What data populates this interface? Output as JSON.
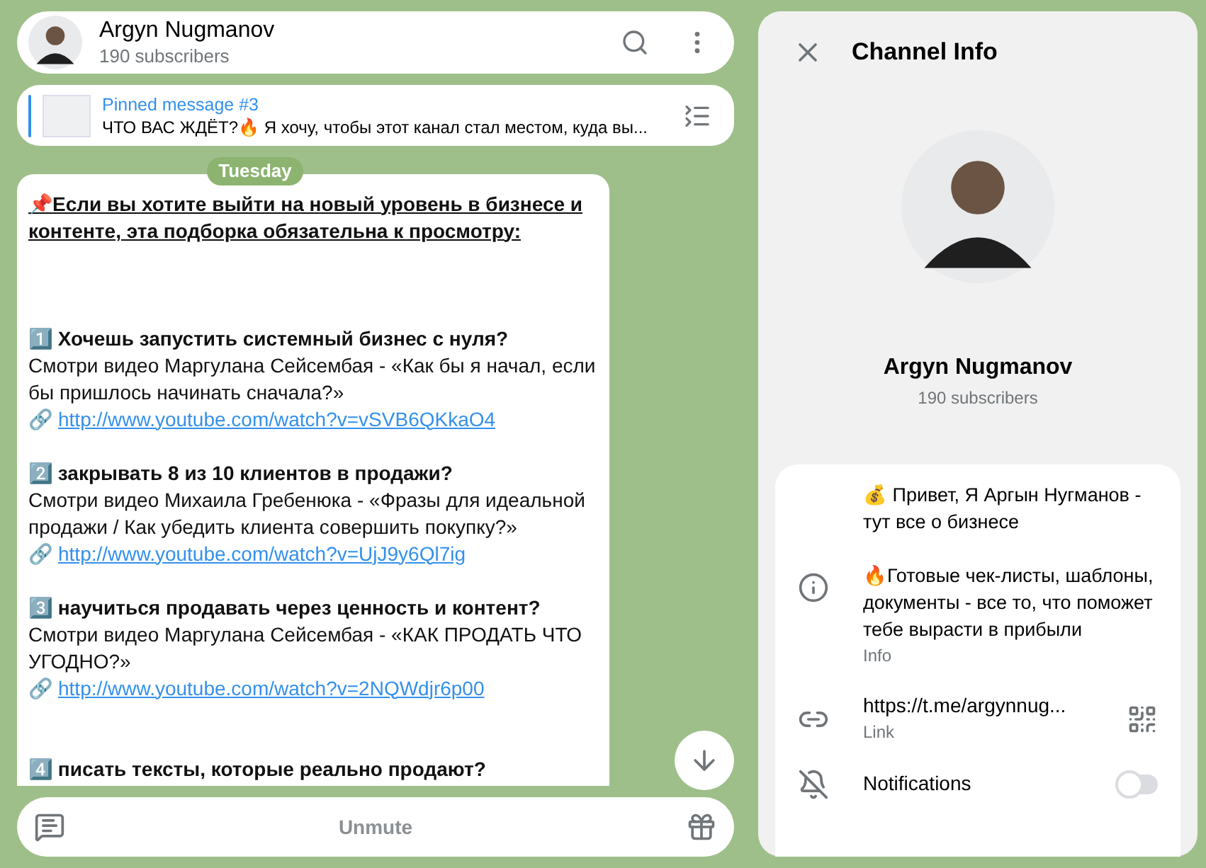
{
  "header": {
    "title": "Argyn Nugmanov",
    "subtitle": "190 subscribers"
  },
  "pinned": {
    "label": "Pinned message #3",
    "text": "ЧТО ВАС ЖДЁТ?🔥 Я хочу, чтобы этот канал стал местом, куда вы..."
  },
  "date_badge": "Tuesday",
  "message": {
    "intro": "📌Если вы хотите выйти на новый уровень в бизнесе и контенте, эта подборка обязательна к просмотру:",
    "items": [
      {
        "number": "1️⃣",
        "heading": "Хочешь запустить системный бизнес с нуля?",
        "body": "Смотри видео Маргулана Сейсембая - «Как бы я начал, если бы пришлось начинать сначала?»",
        "link_icon": "🔗",
        "link": "http://www.youtube.com/watch?v=vSVB6QKkaO4"
      },
      {
        "number": "2️⃣",
        "heading": "закрывать 8 из 10 клиентов в продажи?",
        "body": "Смотри видео Михаила Гребенюка - «Фразы для идеальной продажи / Как убедить клиента совершить покупку?»",
        "link_icon": "🔗",
        "link": "http://www.youtube.com/watch?v=UjJ9y6Ql7ig"
      },
      {
        "number": "3️⃣",
        "heading": "научиться продавать через ценность и контент?",
        "body": "Смотри видео Маргулана Сейсембая - «КАК ПРОДАТЬ ЧТО УГОДНО?»",
        "link_icon": "🔗",
        "link": "http://www.youtube.com/watch?v=2NQWdjr6p00"
      },
      {
        "number": "4️⃣",
        "heading": "писать тексты, которые реально продают?"
      }
    ]
  },
  "composer": {
    "button": "Unmute"
  },
  "info_panel": {
    "title": "Channel Info",
    "name": "Argyn Nugmanov",
    "subtitle": "190 subscribers",
    "description": [
      "💰 Привет, Я Аргын Нугманов - тут все о бизнесе",
      "🔥Готовые чек-листы, шаблоны, документы - все то, что поможет тебе вырасти в прибыли"
    ],
    "description_label": "Info",
    "link": "https://t.me/argynnug...",
    "link_label": "Link",
    "notifications": {
      "label": "Notifications",
      "on": false
    }
  }
}
